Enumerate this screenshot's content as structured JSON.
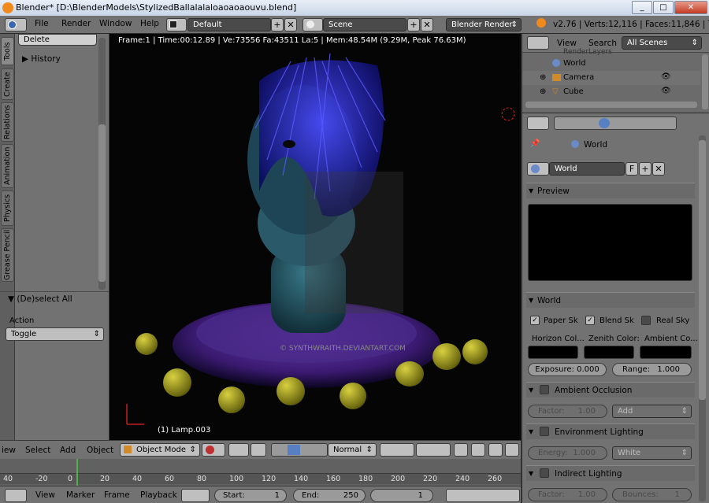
{
  "window": {
    "title": "Blender* [D:\\BlenderModels\\StylizedBallalalaloaoaoaouvu.blend]",
    "min": "_",
    "max": "□",
    "close": "✕"
  },
  "topbar": {
    "menus": [
      "File",
      "Render",
      "Window",
      "Help"
    ],
    "layout": "Default",
    "scene": "Scene",
    "engine": "Blender Render",
    "stats": "v2.76 | Verts:12,116 | Faces:11,846 | Tris:23"
  },
  "toolshelf": {
    "delete": "Delete",
    "history": "History",
    "tabs": [
      "Tools",
      "Create",
      "Relations",
      "Animation",
      "Physics",
      "Grease Pencil"
    ],
    "operator": "(De)select All",
    "action_label": "Action",
    "action_value": "Toggle"
  },
  "viewport": {
    "status": "Frame:1 | Time:00:12.89 | Ve:73556 Fa:43511 La:5 | Mem:48.54M (9.29M, Peak 76.63M)",
    "object_label": "(1) Lamp.003",
    "watermark": "© SYNTHWRAITH.DEVIANTART.COM"
  },
  "vheader": {
    "menus": [
      "iew",
      "Select",
      "Add",
      "Object"
    ],
    "mode": "Object Mode",
    "orientation": "Normal"
  },
  "timeline": {
    "ticks": [
      "40",
      "-20",
      "0",
      "20",
      "40",
      "60",
      "80",
      "100",
      "120",
      "140",
      "160",
      "180",
      "200",
      "220",
      "240",
      "260"
    ],
    "menus": [
      "View",
      "Marker",
      "Frame",
      "Playback"
    ],
    "start_label": "Start:",
    "start_value": "1",
    "end_label": "End:",
    "end_value": "250",
    "current": "1"
  },
  "outliner": {
    "menus": [
      "View",
      "Search"
    ],
    "filter": "All Scenes",
    "items": [
      {
        "label": "RenderLayers"
      },
      {
        "label": "World"
      },
      {
        "label": "Camera"
      },
      {
        "label": "Cube"
      }
    ]
  },
  "props": {
    "breadcrumb": "World",
    "world_name": "World",
    "fake_user": "F",
    "preview": "Preview",
    "world_panel": "World",
    "paper_sky": "Paper Sk",
    "blend_sky": "Blend Sk",
    "real_sky": "Real Sky",
    "horizon": "Horizon Col...",
    "zenith": "Zenith Color:",
    "ambient": "Ambient Co...",
    "exposure": "Exposure: 0.000",
    "range": "Range:",
    "range_value": "1.000",
    "ao": "Ambient Occlusion",
    "ao_factor": "Factor:",
    "ao_factor_value": "1.00",
    "ao_blend": "Add",
    "env": "Environment Lighting",
    "env_energy": "Energy:",
    "env_energy_value": "1.000",
    "env_color": "White",
    "indirect": "Indirect Lighting",
    "ind_factor": "Factor:",
    "ind_factor_value": "1.00",
    "ind_bounces": "Bounces:",
    "ind_bounces_value": "1"
  },
  "colors": {
    "accent": "#5680c2",
    "viewport_bg": "#050505",
    "panel": "#727272"
  }
}
